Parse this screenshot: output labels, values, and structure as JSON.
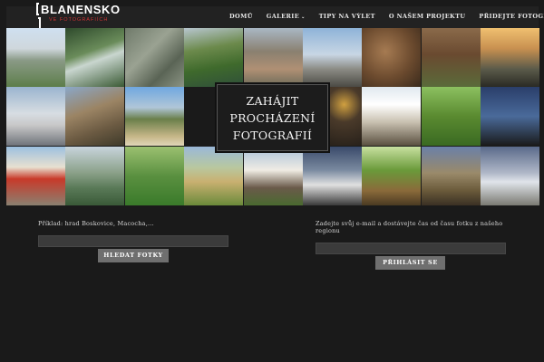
{
  "header": {
    "logo": "BLANENSKO",
    "logo_sub": "VE FOTOGRAFIÍCH",
    "nav": [
      {
        "label": "DOMŮ"
      },
      {
        "label": "GALERIE"
      },
      {
        "label": "TIPY NA VÝLET"
      },
      {
        "label": "O NAŠEM PROJEKTU"
      },
      {
        "label": "PŘIDEJTE FOTOGRAFII"
      }
    ],
    "galerie_caret": "⌄"
  },
  "hero": {
    "cta_line1": "ZAHÁJIT",
    "cta_line2": "PROCHÁZENÍ",
    "cta_line3": "FOTOGRAFIÍ"
  },
  "search": {
    "hint": "Příklad: hrad Boskovice, Macocha,...",
    "value": "",
    "button": "HLEDAT FOTKY"
  },
  "subscribe": {
    "hint": "Zadejte svůj e-mail a dostávejte čas od času fotku z našeho regionu",
    "value": "",
    "button": "PŘIHLÁSIT SE"
  },
  "colors": {
    "background": "#1a1a1a",
    "header": "#222222",
    "button": "#6f6f6f",
    "input": "#3b3b3b",
    "logo_sub": "#cc3333"
  },
  "photos": [
    {
      "name": "photo-chateau-lawn",
      "bg": "linear-gradient(180deg,#cfe0f0 0%,#cfd7dc 35%,#8a9a86 55%,#5d7e4a 100%)"
    },
    {
      "name": "photo-waterfall",
      "bg": "linear-gradient(160deg,#2e4a2c 0%,#6a8c5a 40%,#c9d6cf 55%,#3a5a34 100%)"
    },
    {
      "name": "photo-stone-carving",
      "bg": "linear-gradient(135deg,#6f7a6a 0%,#9aa292 40%,#5a6455 70%,#8b9484 100%)"
    },
    {
      "name": "photo-aerial-pond",
      "bg": "linear-gradient(170deg,#b8c6cf 0%,#6c8a4c 35%,#3f6a2c 65%,#2f4f3a 100%)"
    },
    {
      "name": "photo-aerial-town",
      "bg": "linear-gradient(180deg,#a9b7c4 0%,#8a8070 40%,#b09074 70%,#6a6a58 100%)"
    },
    {
      "name": "photo-windmill",
      "bg": "linear-gradient(180deg,#8eb3d8 0%,#c8d6e4 45%,#8b8b84 70%,#4b4a44 100%)"
    },
    {
      "name": "photo-cave-arch",
      "bg": "radial-gradient(ellipse at 40% 40%,#a67b52 0%,#6b4a2e 55%,#3a2a1c 100%)"
    },
    {
      "name": "photo-autumn-field",
      "bg": "linear-gradient(180deg,#8a6a4a 0%,#6a4a30 45%,#5a6a3a 100%)"
    },
    {
      "name": "photo-sunset-church",
      "bg": "linear-gradient(180deg,#f0c070 0%,#c89050 35%,#5a5a4a 70%,#2a2a24 100%)"
    },
    {
      "name": "photo-snowy-factory",
      "bg": "linear-gradient(180deg,#9ab4cf 0%,#d7dde2 45%,#c8c8c8 65%,#6f737a 100%)"
    },
    {
      "name": "photo-castle-ruins",
      "bg": "linear-gradient(160deg,#8aa7c8 0%,#9b8464 40%,#6b5a42 70%,#3e3a2a 100%)"
    },
    {
      "name": "photo-lake-forest",
      "bg": "linear-gradient(180deg,#6fa7e0 0%,#b0c6d8 35%,#6a7f4a 55%,#c8b88a 85%,#e0d6b8 100%)"
    },
    {
      "name": "photo-night-lantern",
      "bg": "radial-gradient(circle at 70% 30%,#d0a040 0%,#4a3a2a 30%,#161412 100%)"
    },
    {
      "name": "photo-white-house",
      "bg": "linear-gradient(180deg,#e0e8ee 0%,#ffffff 30%,#c8c0b0 60%,#5a5040 100%)"
    },
    {
      "name": "photo-meadow-tree",
      "bg": "linear-gradient(180deg,#8cc060 0%,#5a8a30 50%,#3a6a22 100%)"
    },
    {
      "name": "photo-tree-silhouette",
      "bg": "linear-gradient(180deg,#2a3e6a 0%,#4a6a9a 50%,#1a1a1a 100%)"
    },
    {
      "name": "photo-baroque-palace",
      "bg": "linear-gradient(180deg,#9cc0e0 0%,#e8e0d0 35%,#c83a2a 55%,#8a8070 100%)"
    },
    {
      "name": "photo-valley-haze",
      "bg": "linear-gradient(180deg,#c8d4dc 0%,#8aa088 45%,#5a7a58 70%,#3a5a38 100%)"
    },
    {
      "name": "photo-park-trees",
      "bg": "linear-gradient(180deg,#9bc070 0%,#5a9040 50%,#3a7a2a 100%)"
    },
    {
      "name": "photo-harvest-fields",
      "bg": "linear-gradient(180deg,#9ab8d8 0%,#b8c8a0 35%,#c8b070 60%,#6a8a3a 100%)"
    },
    {
      "name": "photo-cottage",
      "bg": "linear-gradient(180deg,#a8c0d8 0%,#f0ece4 40%,#6a5a4a 70%,#4a6a30 100%)"
    },
    {
      "name": "photo-chapel",
      "bg": "linear-gradient(180deg,#3a4a6a 0%,#7a8aa0 40%,#e0e0e0 65%,#3a3a3a 100%)"
    },
    {
      "name": "photo-forest-path",
      "bg": "linear-gradient(180deg,#c8e0a0 0%,#6a9a3a 40%,#8a6a3a 75%,#4a3a22 100%)"
    },
    {
      "name": "photo-ruined-castle",
      "bg": "linear-gradient(180deg,#6a80a8 0%,#9a8a6a 45%,#6a5a3a 75%,#3a3024 100%)"
    },
    {
      "name": "photo-winter-tree",
      "bg": "linear-gradient(180deg,#5a6a8a 0%,#b0b8c8 45%,#e0e4ea 60%,#7a7a72 100%)"
    },
    {
      "name": "photo-manor-square",
      "bg": "linear-gradient(180deg,#3a6ab0 0%,#8aa8d0 35%,#c87a4a 55%,#6a5a48 100%)"
    },
    {
      "name": "photo-chateau-red",
      "bg": "linear-gradient(180deg,#e8d8c0 0%,#b85a4a 40%,#9a4a3a 60%,#6a7a4a 100%)"
    },
    {
      "name": "photo-rock-statue",
      "bg": "linear-gradient(160deg,#a0a89a 0%,#7a8268 45%,#4a5a40 100%)"
    },
    {
      "name": "photo-church-sunset",
      "bg": "linear-gradient(180deg,#e0b070 0%,#c8804a 45%,#8a5a3a 70%,#3a3028 100%)"
    }
  ]
}
